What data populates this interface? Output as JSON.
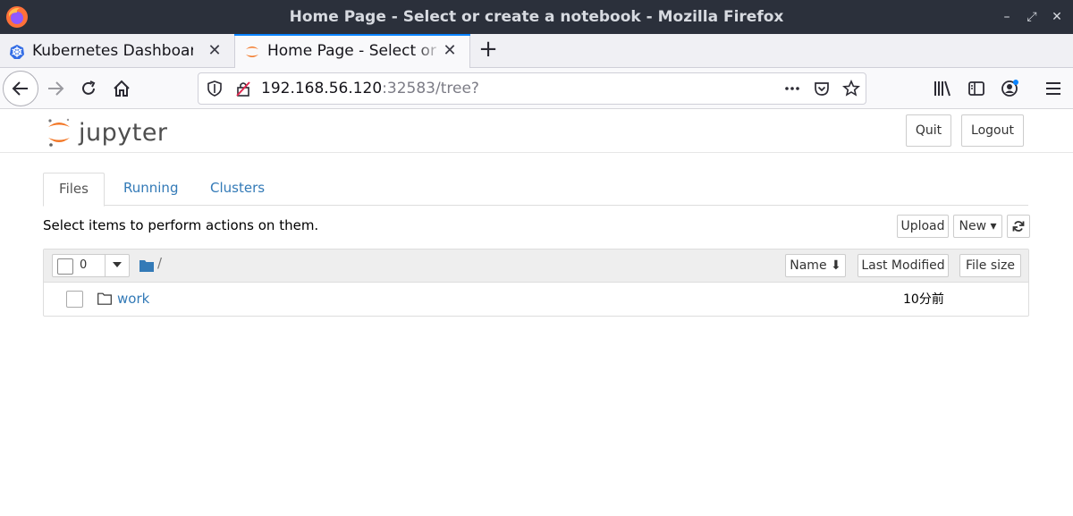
{
  "window": {
    "title": "Home Page - Select or create a notebook - Mozilla Firefox",
    "controls": {
      "minimize": "–",
      "restore": "⤢",
      "close": "✕"
    }
  },
  "browser": {
    "tabs": [
      {
        "label": "Kubernetes Dashboard",
        "icon": "kubernetes-icon",
        "active": false
      },
      {
        "label": "Home Page - Select or create a notebook",
        "icon": "jupyter-icon",
        "active": true
      }
    ],
    "new_tab": "+",
    "url": {
      "host": "192.168.56.120",
      "rest": ":32583/tree?"
    },
    "icons": [
      "back-icon",
      "forward-icon",
      "reload-icon",
      "home-icon",
      "shield-icon",
      "insecure-lock-icon",
      "more-icon",
      "pocket-icon",
      "bookmark-star-icon",
      "library-icon",
      "sidebar-icon",
      "account-icon",
      "menu-icon"
    ]
  },
  "jupyter": {
    "logo_text": "jupyter",
    "header_buttons": {
      "quit": "Quit",
      "logout": "Logout"
    },
    "tabs": [
      {
        "label": "Files",
        "active": true
      },
      {
        "label": "Running",
        "active": false
      },
      {
        "label": "Clusters",
        "active": false
      }
    ],
    "hint": "Select items to perform actions on them.",
    "actions": {
      "upload": "Upload",
      "new": "New ▾"
    },
    "list": {
      "selected_count": "0",
      "breadcrumb": "/",
      "columns": {
        "name": "Name ⬇",
        "modified": "Last Modified",
        "size": "File size"
      },
      "rows": [
        {
          "name": "work",
          "modified": "10分前"
        }
      ]
    },
    "colors": {
      "link": "#337ab7",
      "logo_orange": "#f37726"
    }
  }
}
